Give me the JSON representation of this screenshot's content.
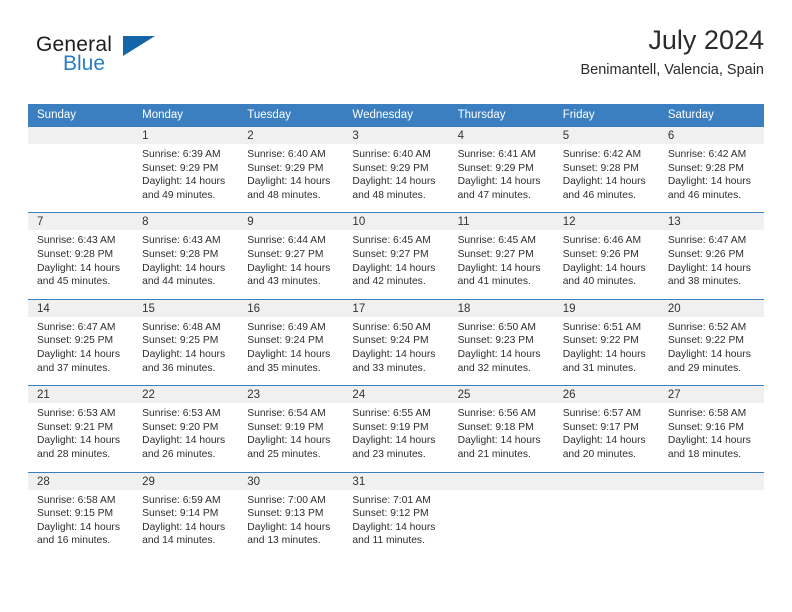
{
  "brand": {
    "name_top": "General",
    "name_bottom": "Blue",
    "triangle_icon": "triangle-icon",
    "color_dark": "#1d1d1d",
    "color_blue": "#2b7cc4"
  },
  "header": {
    "title": "July 2024",
    "subtitle": "Benimantell, Valencia, Spain"
  },
  "theme": {
    "header_row_bg": "#3c7fc1",
    "daynum_bg": "#f0f0f0",
    "cell_bg": "#ffffff",
    "text": "#2e2e2e"
  },
  "weekdays": [
    "Sunday",
    "Monday",
    "Tuesday",
    "Wednesday",
    "Thursday",
    "Friday",
    "Saturday"
  ],
  "weeks": [
    [
      {
        "day": "",
        "sunrise": "",
        "sunset": "",
        "daylight_1": "",
        "daylight_2": ""
      },
      {
        "day": "1",
        "sunrise": "Sunrise: 6:39 AM",
        "sunset": "Sunset: 9:29 PM",
        "daylight_1": "Daylight: 14 hours",
        "daylight_2": "and 49 minutes."
      },
      {
        "day": "2",
        "sunrise": "Sunrise: 6:40 AM",
        "sunset": "Sunset: 9:29 PM",
        "daylight_1": "Daylight: 14 hours",
        "daylight_2": "and 48 minutes."
      },
      {
        "day": "3",
        "sunrise": "Sunrise: 6:40 AM",
        "sunset": "Sunset: 9:29 PM",
        "daylight_1": "Daylight: 14 hours",
        "daylight_2": "and 48 minutes."
      },
      {
        "day": "4",
        "sunrise": "Sunrise: 6:41 AM",
        "sunset": "Sunset: 9:29 PM",
        "daylight_1": "Daylight: 14 hours",
        "daylight_2": "and 47 minutes."
      },
      {
        "day": "5",
        "sunrise": "Sunrise: 6:42 AM",
        "sunset": "Sunset: 9:28 PM",
        "daylight_1": "Daylight: 14 hours",
        "daylight_2": "and 46 minutes."
      },
      {
        "day": "6",
        "sunrise": "Sunrise: 6:42 AM",
        "sunset": "Sunset: 9:28 PM",
        "daylight_1": "Daylight: 14 hours",
        "daylight_2": "and 46 minutes."
      }
    ],
    [
      {
        "day": "7",
        "sunrise": "Sunrise: 6:43 AM",
        "sunset": "Sunset: 9:28 PM",
        "daylight_1": "Daylight: 14 hours",
        "daylight_2": "and 45 minutes."
      },
      {
        "day": "8",
        "sunrise": "Sunrise: 6:43 AM",
        "sunset": "Sunset: 9:28 PM",
        "daylight_1": "Daylight: 14 hours",
        "daylight_2": "and 44 minutes."
      },
      {
        "day": "9",
        "sunrise": "Sunrise: 6:44 AM",
        "sunset": "Sunset: 9:27 PM",
        "daylight_1": "Daylight: 14 hours",
        "daylight_2": "and 43 minutes."
      },
      {
        "day": "10",
        "sunrise": "Sunrise: 6:45 AM",
        "sunset": "Sunset: 9:27 PM",
        "daylight_1": "Daylight: 14 hours",
        "daylight_2": "and 42 minutes."
      },
      {
        "day": "11",
        "sunrise": "Sunrise: 6:45 AM",
        "sunset": "Sunset: 9:27 PM",
        "daylight_1": "Daylight: 14 hours",
        "daylight_2": "and 41 minutes."
      },
      {
        "day": "12",
        "sunrise": "Sunrise: 6:46 AM",
        "sunset": "Sunset: 9:26 PM",
        "daylight_1": "Daylight: 14 hours",
        "daylight_2": "and 40 minutes."
      },
      {
        "day": "13",
        "sunrise": "Sunrise: 6:47 AM",
        "sunset": "Sunset: 9:26 PM",
        "daylight_1": "Daylight: 14 hours",
        "daylight_2": "and 38 minutes."
      }
    ],
    [
      {
        "day": "14",
        "sunrise": "Sunrise: 6:47 AM",
        "sunset": "Sunset: 9:25 PM",
        "daylight_1": "Daylight: 14 hours",
        "daylight_2": "and 37 minutes."
      },
      {
        "day": "15",
        "sunrise": "Sunrise: 6:48 AM",
        "sunset": "Sunset: 9:25 PM",
        "daylight_1": "Daylight: 14 hours",
        "daylight_2": "and 36 minutes."
      },
      {
        "day": "16",
        "sunrise": "Sunrise: 6:49 AM",
        "sunset": "Sunset: 9:24 PM",
        "daylight_1": "Daylight: 14 hours",
        "daylight_2": "and 35 minutes."
      },
      {
        "day": "17",
        "sunrise": "Sunrise: 6:50 AM",
        "sunset": "Sunset: 9:24 PM",
        "daylight_1": "Daylight: 14 hours",
        "daylight_2": "and 33 minutes."
      },
      {
        "day": "18",
        "sunrise": "Sunrise: 6:50 AM",
        "sunset": "Sunset: 9:23 PM",
        "daylight_1": "Daylight: 14 hours",
        "daylight_2": "and 32 minutes."
      },
      {
        "day": "19",
        "sunrise": "Sunrise: 6:51 AM",
        "sunset": "Sunset: 9:22 PM",
        "daylight_1": "Daylight: 14 hours",
        "daylight_2": "and 31 minutes."
      },
      {
        "day": "20",
        "sunrise": "Sunrise: 6:52 AM",
        "sunset": "Sunset: 9:22 PM",
        "daylight_1": "Daylight: 14 hours",
        "daylight_2": "and 29 minutes."
      }
    ],
    [
      {
        "day": "21",
        "sunrise": "Sunrise: 6:53 AM",
        "sunset": "Sunset: 9:21 PM",
        "daylight_1": "Daylight: 14 hours",
        "daylight_2": "and 28 minutes."
      },
      {
        "day": "22",
        "sunrise": "Sunrise: 6:53 AM",
        "sunset": "Sunset: 9:20 PM",
        "daylight_1": "Daylight: 14 hours",
        "daylight_2": "and 26 minutes."
      },
      {
        "day": "23",
        "sunrise": "Sunrise: 6:54 AM",
        "sunset": "Sunset: 9:19 PM",
        "daylight_1": "Daylight: 14 hours",
        "daylight_2": "and 25 minutes."
      },
      {
        "day": "24",
        "sunrise": "Sunrise: 6:55 AM",
        "sunset": "Sunset: 9:19 PM",
        "daylight_1": "Daylight: 14 hours",
        "daylight_2": "and 23 minutes."
      },
      {
        "day": "25",
        "sunrise": "Sunrise: 6:56 AM",
        "sunset": "Sunset: 9:18 PM",
        "daylight_1": "Daylight: 14 hours",
        "daylight_2": "and 21 minutes."
      },
      {
        "day": "26",
        "sunrise": "Sunrise: 6:57 AM",
        "sunset": "Sunset: 9:17 PM",
        "daylight_1": "Daylight: 14 hours",
        "daylight_2": "and 20 minutes."
      },
      {
        "day": "27",
        "sunrise": "Sunrise: 6:58 AM",
        "sunset": "Sunset: 9:16 PM",
        "daylight_1": "Daylight: 14 hours",
        "daylight_2": "and 18 minutes."
      }
    ],
    [
      {
        "day": "28",
        "sunrise": "Sunrise: 6:58 AM",
        "sunset": "Sunset: 9:15 PM",
        "daylight_1": "Daylight: 14 hours",
        "daylight_2": "and 16 minutes."
      },
      {
        "day": "29",
        "sunrise": "Sunrise: 6:59 AM",
        "sunset": "Sunset: 9:14 PM",
        "daylight_1": "Daylight: 14 hours",
        "daylight_2": "and 14 minutes."
      },
      {
        "day": "30",
        "sunrise": "Sunrise: 7:00 AM",
        "sunset": "Sunset: 9:13 PM",
        "daylight_1": "Daylight: 14 hours",
        "daylight_2": "and 13 minutes."
      },
      {
        "day": "31",
        "sunrise": "Sunrise: 7:01 AM",
        "sunset": "Sunset: 9:12 PM",
        "daylight_1": "Daylight: 14 hours",
        "daylight_2": "and 11 minutes."
      },
      {
        "day": "",
        "sunrise": "",
        "sunset": "",
        "daylight_1": "",
        "daylight_2": ""
      },
      {
        "day": "",
        "sunrise": "",
        "sunset": "",
        "daylight_1": "",
        "daylight_2": ""
      },
      {
        "day": "",
        "sunrise": "",
        "sunset": "",
        "daylight_1": "",
        "daylight_2": ""
      }
    ]
  ]
}
